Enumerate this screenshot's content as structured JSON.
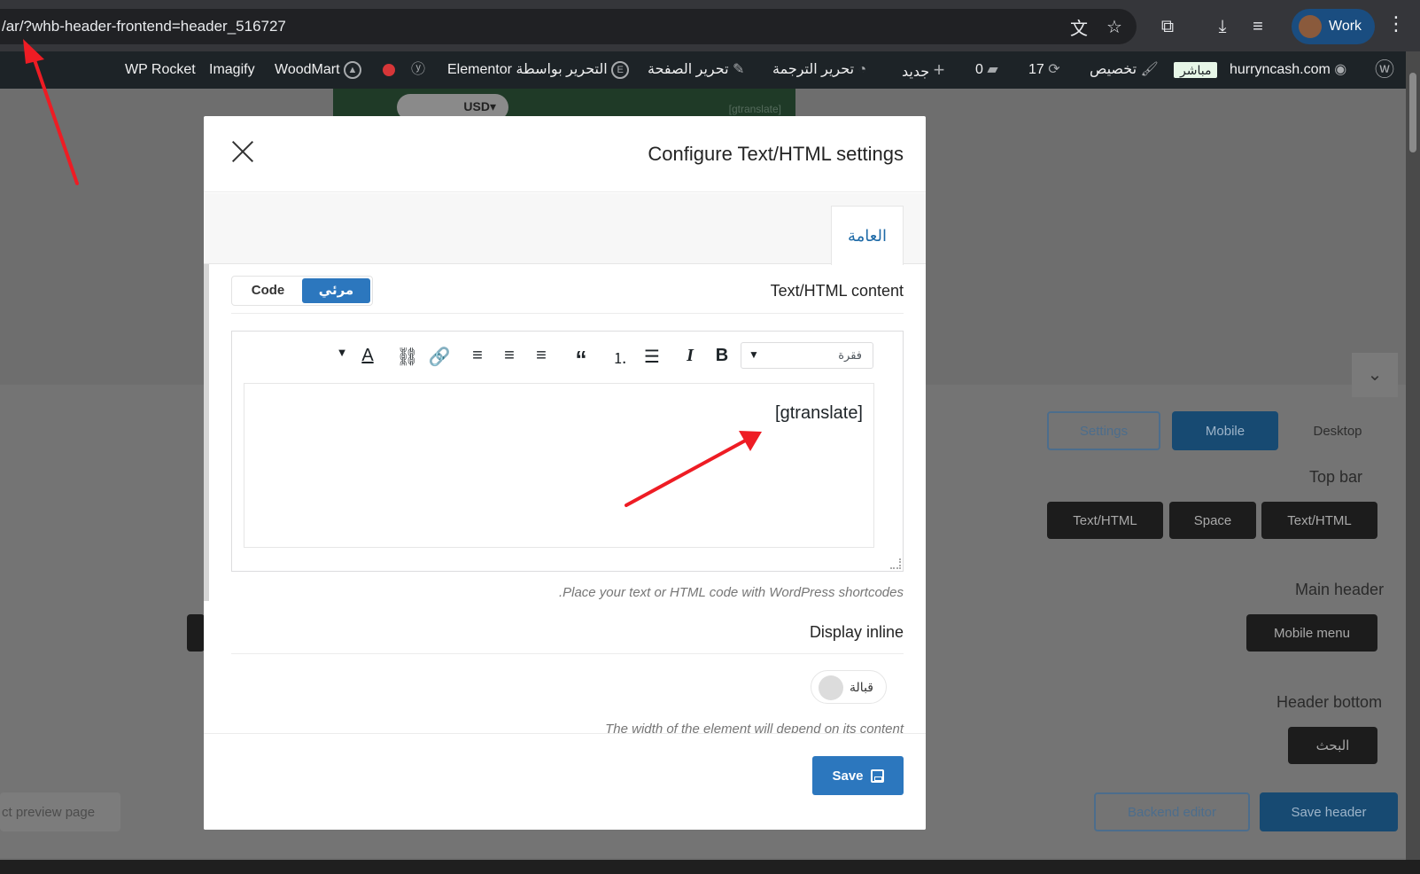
{
  "browser": {
    "url": "/ar/?whb-header-frontend=header_516727",
    "profile_label": "Work",
    "colors": {
      "chrome": "#35363a",
      "profile": "#1a4d80"
    }
  },
  "admin_bar": {
    "items": {
      "wp_rocket": "WP Rocket",
      "imagify": "Imagify",
      "woodmart": "WoodMart",
      "elementor": "Elementor التحرير بواسطة",
      "edit_page": "تحرير الصفحة",
      "edit_translation": "تحرير الترجمة",
      "new": "جديد",
      "comments": "0",
      "updates": "17",
      "customize": "تخصيص",
      "live": "مباشر",
      "site": "hurryncash.com"
    }
  },
  "background": {
    "currency": "USD▾",
    "tag": "[gtranslate]",
    "buttons": {
      "settings": "Settings",
      "mobile": "Mobile",
      "desktop": "Desktop",
      "text_html_1": "Text/HTML",
      "space": "Space",
      "text_html_2": "Text/HTML",
      "mobile_menu": "Mobile menu",
      "search": "البحث",
      "backend_editor": "Backend editor",
      "save_header": "Save header",
      "preview_page": "ct preview page"
    },
    "labels": {
      "top_bar": "Top bar",
      "main_header": "Main header",
      "header_bottom": "Header bottom"
    }
  },
  "modal": {
    "title": "Configure Text/HTML settings",
    "tab_general": "العامة",
    "content_label": "Text/HTML content",
    "mode_visual": "مرئي",
    "mode_code": "Code",
    "format_value": "فقرة",
    "editor_value": "[gtranslate]",
    "hint_content": ".Place your text or HTML code with WordPress shortcodes",
    "display_inline_label": "Display inline",
    "toggle_label": "قبالة",
    "hint_inline": "The width of the element will depend on its content",
    "save_label": "Save",
    "colors": {
      "primary": "#2c77be",
      "tab_text": "#1e6aa7"
    }
  }
}
